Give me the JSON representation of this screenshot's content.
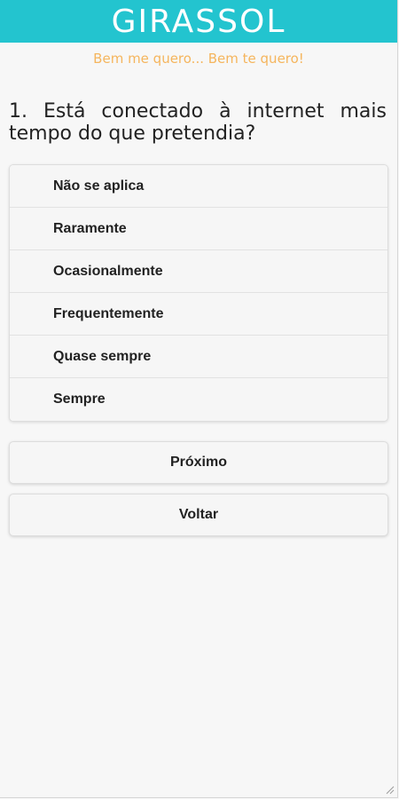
{
  "app": {
    "title": "GIRASSOL",
    "tagline": "Bem me quero... Bem te quero!"
  },
  "question": {
    "text": "1. Está conectado à internet mais tempo do que pretendia?"
  },
  "options": [
    {
      "label": "Não se aplica"
    },
    {
      "label": "Raramente"
    },
    {
      "label": "Ocasionalmente"
    },
    {
      "label": "Frequentemente"
    },
    {
      "label": "Quase sempre"
    },
    {
      "label": "Sempre"
    }
  ],
  "buttons": {
    "next_label": "Próximo",
    "back_label": "Voltar"
  },
  "colors": {
    "header": "#23c4cf",
    "tagline": "#f5b55d",
    "background": "#f7f7f7"
  }
}
